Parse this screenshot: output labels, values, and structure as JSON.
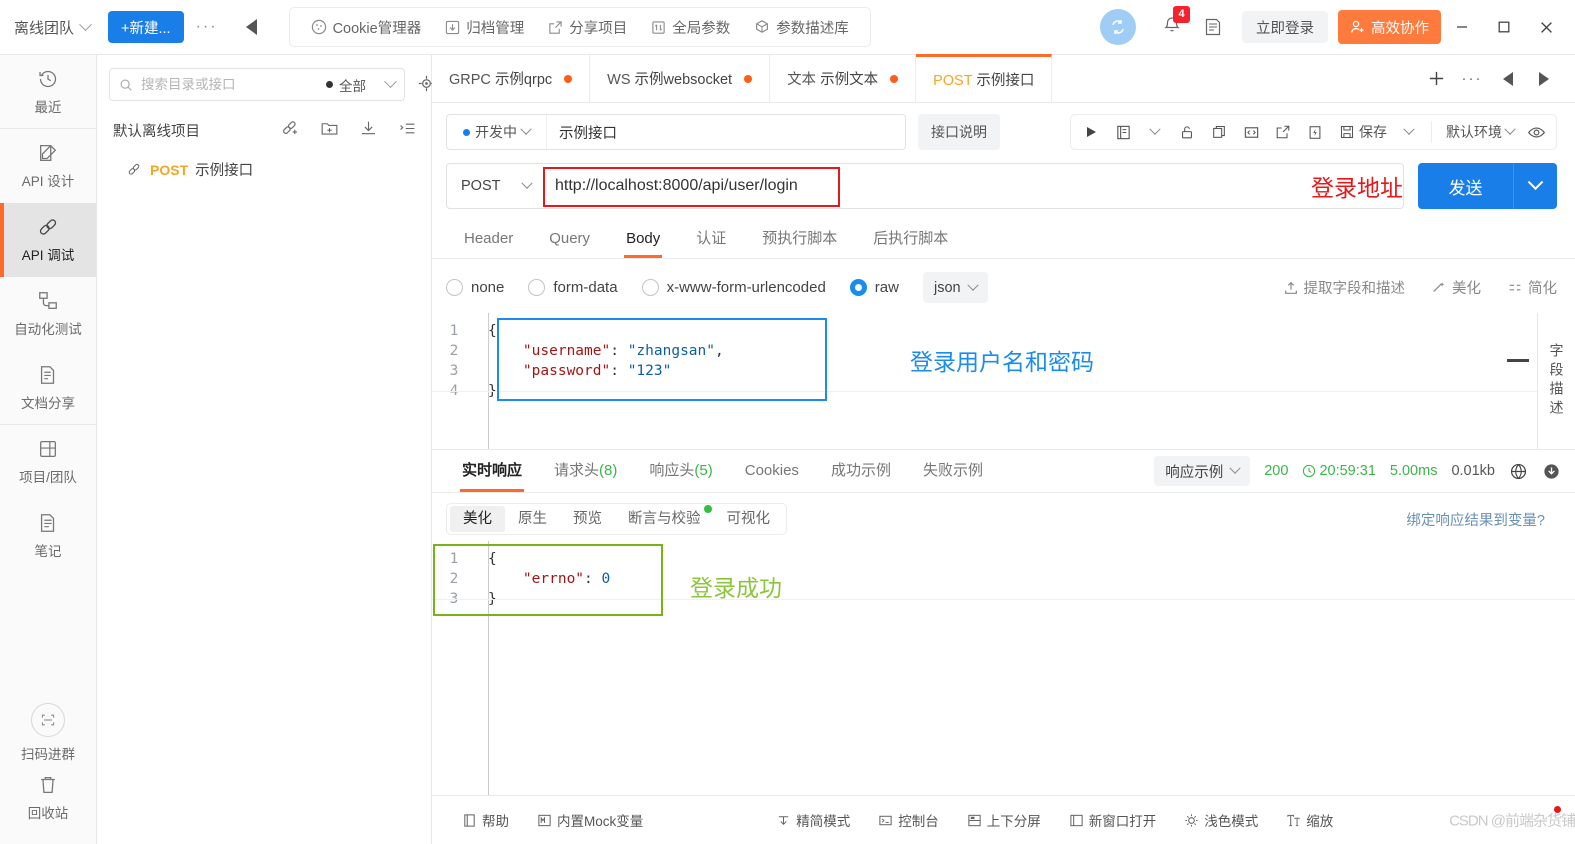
{
  "titlebar": {
    "team": "离线团队",
    "new_button": "+新建...",
    "dots": "···",
    "menu": [
      {
        "label": "Cookie管理器",
        "icon": "cookie-icon"
      },
      {
        "label": "归档管理",
        "icon": "archive-icon"
      },
      {
        "label": "分享项目",
        "icon": "share-icon"
      },
      {
        "label": "全局参数",
        "icon": "params-icon"
      },
      {
        "label": "参数描述库",
        "icon": "library-icon"
      }
    ],
    "notification_count": "4",
    "login_button": "立即登录",
    "collab_button": "高效协作"
  },
  "rail": {
    "items": [
      {
        "label": "最近",
        "icon": "history-icon",
        "active": false
      },
      {
        "label": "API 设计",
        "icon": "design-icon",
        "active": false
      },
      {
        "label": "API 调试",
        "icon": "debug-icon",
        "active": true
      },
      {
        "label": "自动化测试",
        "icon": "automation-icon",
        "active": false
      },
      {
        "label": "文档分享",
        "icon": "doc-share-icon",
        "active": false
      },
      {
        "label": "项目/团队",
        "icon": "project-icon",
        "active": false
      },
      {
        "label": "笔记",
        "icon": "note-icon",
        "active": false
      }
    ],
    "bottom": [
      {
        "label": "扫码进群",
        "icon": "qr-icon"
      },
      {
        "label": "回收站",
        "icon": "trash-icon"
      }
    ]
  },
  "tree": {
    "search_placeholder": "搜索目录或接口",
    "filter_label": "全部",
    "project_name": "默认离线项目",
    "api": {
      "method": "POST",
      "name": "示例接口"
    }
  },
  "tabs": [
    {
      "pre": "GRPC",
      "label": "示例qrpc",
      "dirty": true,
      "active": false
    },
    {
      "pre": "WS",
      "label": "示例websocket",
      "dirty": true,
      "active": false
    },
    {
      "pre": "文本",
      "label": "示例文本",
      "dirty": true,
      "active": false
    },
    {
      "pre": "POST",
      "label": "示例接口",
      "dirty": false,
      "active": true
    }
  ],
  "meta": {
    "status": "开发中",
    "name_value": "示例接口",
    "desc_button": "接口说明",
    "save_label": "保存",
    "env_label": "默认环境"
  },
  "url": {
    "method": "POST",
    "value": "http://localhost:8000/api/user/login",
    "annotation": "登录地址",
    "annotation_color": "#e4191c",
    "send_button": "发送"
  },
  "request_tabs": [
    {
      "label": "Header",
      "active": false
    },
    {
      "label": "Query",
      "active": false
    },
    {
      "label": "Body",
      "active": true
    },
    {
      "label": "认证",
      "active": false
    },
    {
      "label": "预执行脚本",
      "active": false
    },
    {
      "label": "后执行脚本",
      "active": false
    }
  ],
  "body": {
    "options": [
      {
        "label": "none",
        "selected": false
      },
      {
        "label": "form-data",
        "selected": false
      },
      {
        "label": "x-www-form-urlencoded",
        "selected": false
      },
      {
        "label": "raw",
        "selected": true
      }
    ],
    "format": "json",
    "actions": [
      {
        "label": "提取字段和描述",
        "icon": "extract-icon"
      },
      {
        "label": "美化",
        "icon": "beautify-icon"
      },
      {
        "label": "简化",
        "icon": "simplify-icon"
      }
    ],
    "code_lines": [
      {
        "n": "1",
        "text": "{"
      },
      {
        "n": "2",
        "text": "    \"username\": \"zhangsan\","
      },
      {
        "n": "3",
        "text": "    \"password\": \"123\""
      },
      {
        "n": "4",
        "text": "}"
      }
    ],
    "annotation": "登录用户名和密码",
    "annotation_color": "#1a8cf0",
    "side_label": "字段描述"
  },
  "response": {
    "tabs": [
      {
        "label": "实时响应",
        "count": "",
        "active": true
      },
      {
        "label": "请求头",
        "count": "(8)",
        "active": false
      },
      {
        "label": "响应头",
        "count": "(5)",
        "active": false
      },
      {
        "label": "Cookies",
        "count": "",
        "active": false
      },
      {
        "label": "成功示例",
        "count": "",
        "active": false
      },
      {
        "label": "失败示例",
        "count": "",
        "active": false
      }
    ],
    "example_select": "响应示例",
    "status_code": "200",
    "time": "20:59:31",
    "duration": "5.00ms",
    "size": "0.01kb",
    "subtabs": [
      {
        "label": "美化",
        "active": true,
        "dot": false
      },
      {
        "label": "原生",
        "active": false,
        "dot": false
      },
      {
        "label": "预览",
        "active": false,
        "dot": false
      },
      {
        "label": "断言与校验",
        "active": false,
        "dot": true
      },
      {
        "label": "可视化",
        "active": false,
        "dot": false
      }
    ],
    "bind_label": "绑定响应结果到变量?",
    "code_lines": [
      {
        "n": "1",
        "text": "{"
      },
      {
        "n": "2",
        "text": "    \"errno\": 0"
      },
      {
        "n": "3",
        "text": "}"
      }
    ],
    "annotation": "登录成功",
    "annotation_color": "#8cc63e"
  },
  "statusbar": {
    "items": [
      {
        "label": "帮助",
        "icon": "help-icon"
      },
      {
        "label": "内置Mock变量",
        "icon": "mock-icon"
      },
      {
        "label": "精简模式",
        "icon": "compact-icon"
      },
      {
        "label": "控制台",
        "icon": "console-icon"
      },
      {
        "label": "上下分屏",
        "icon": "split-icon"
      },
      {
        "label": "新窗口打开",
        "icon": "newwindow-icon"
      },
      {
        "label": "浅色模式",
        "icon": "light-mode-icon"
      },
      {
        "label": "缩放",
        "icon": "zoom-icon"
      }
    ],
    "watermark": "CSDN @前端杂货铺"
  }
}
